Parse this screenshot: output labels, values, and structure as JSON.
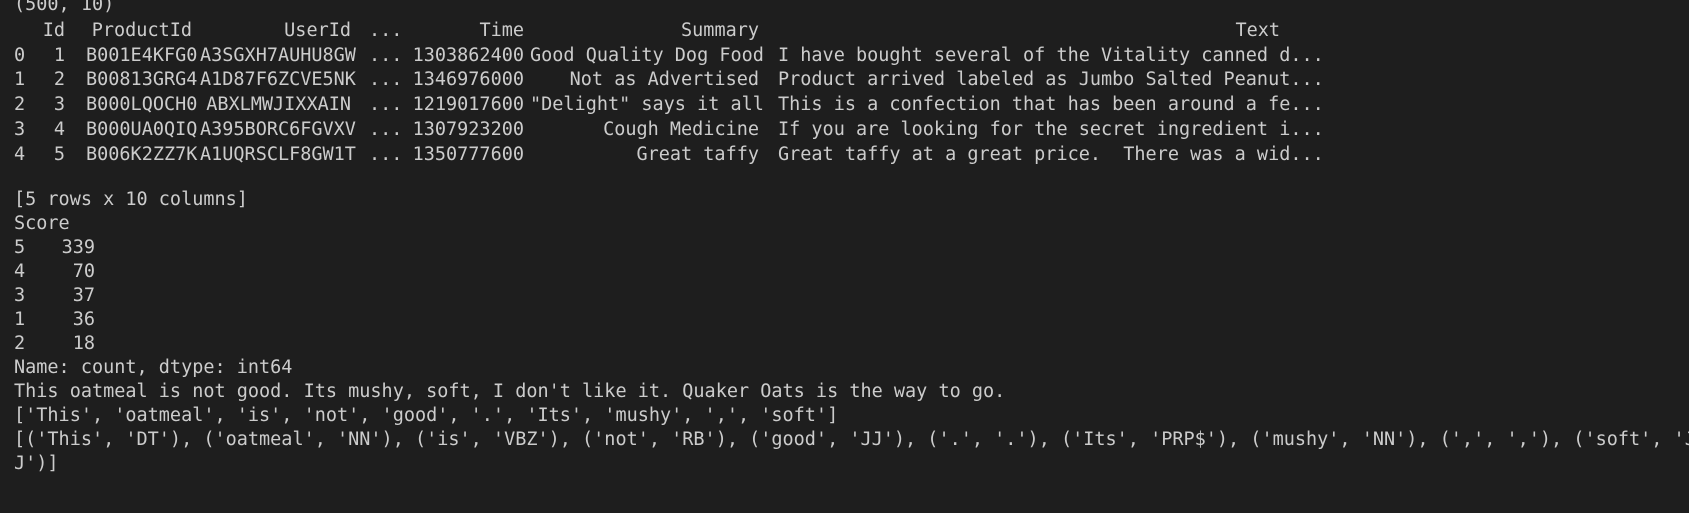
{
  "terminal": {
    "shape_line": "(500, 10)",
    "df_head": {
      "headers": [
        "Id",
        "ProductId",
        "UserId",
        "...",
        "Time",
        "Summary",
        "Text"
      ],
      "rows": [
        {
          "index": "0",
          "cells": [
            "1",
            "B001E4KFG0",
            "A3SGXH7AUHU8GW",
            "...",
            "1303862400",
            "Good Quality Dog Food",
            "I have bought several of the Vitality canned d..."
          ]
        },
        {
          "index": "1",
          "cells": [
            "2",
            "B00813GRG4",
            "A1D87F6ZCVE5NK",
            "...",
            "1346976000",
            "Not as Advertised",
            "Product arrived labeled as Jumbo Salted Peanut..."
          ]
        },
        {
          "index": "2",
          "cells": [
            "3",
            "B000LQOCH0",
            "ABXLMWJIXXAIN",
            "...",
            "1219017600",
            "\"Delight\" says it all",
            "This is a confection that has been around a fe..."
          ]
        },
        {
          "index": "3",
          "cells": [
            "4",
            "B000UA0QIQ",
            "A395BORC6FGVXV",
            "...",
            "1307923200",
            "Cough Medicine",
            "If you are looking for the secret ingredient i..."
          ]
        },
        {
          "index": "4",
          "cells": [
            "5",
            "B006K2ZZ7K",
            "A1UQRSCLF8GW1T",
            "...",
            "1350777600",
            "Great taffy",
            "Great taffy at a great price.  There was a wid..."
          ]
        }
      ]
    },
    "rows_cols_line": "[5 rows x 10 columns]",
    "score": {
      "header": "Score",
      "rows": [
        {
          "label": "5",
          "count": "339"
        },
        {
          "label": "4",
          "count": "70"
        },
        {
          "label": "3",
          "count": "37"
        },
        {
          "label": "1",
          "count": "36"
        },
        {
          "label": "2",
          "count": "18"
        }
      ],
      "footer": "Name: count, dtype: int64"
    },
    "sample_text": "This oatmeal is not good. Its mushy, soft, I don't like it. Quaker Oats is the way to go.",
    "tokens_line": "['This', 'oatmeal', 'is', 'not', 'good', '.', 'Its', 'mushy', ',', 'soft']",
    "pos_line_1": "[('This', 'DT'), ('oatmeal', 'NN'), ('is', 'VBZ'), ('not', 'RB'), ('good', 'JJ'), ('.', '.'), ('Its', 'PRP$'), ('mushy', 'NN'), (',', ','), ('soft', 'J",
    "pos_line_2": "J')]"
  }
}
